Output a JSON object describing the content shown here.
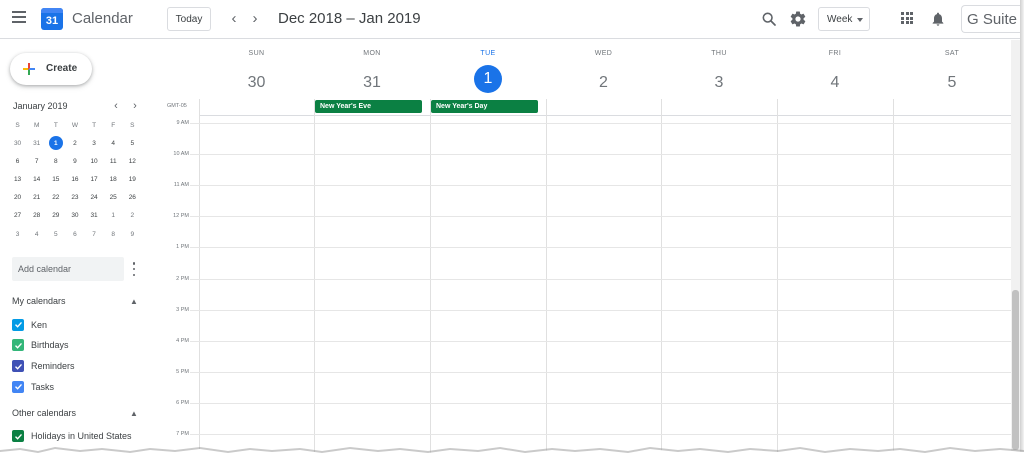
{
  "header": {
    "app_title": "Calendar",
    "logo_text": "31",
    "today_label": "Today",
    "prev_icon": "chevron-left-icon",
    "next_icon": "chevron-right-icon",
    "date_range": "Dec 2018 – Jan 2019",
    "view_label": "Week",
    "gsuite_label": "G Suite"
  },
  "sidebar": {
    "create_label": "Create",
    "mini_calendar": {
      "title": "January 2019",
      "dow": [
        "S",
        "M",
        "T",
        "W",
        "T",
        "F",
        "S"
      ],
      "weeks": [
        [
          "30",
          "31",
          "1",
          "2",
          "3",
          "4",
          "5"
        ],
        [
          "6",
          "7",
          "8",
          "9",
          "10",
          "11",
          "12"
        ],
        [
          "13",
          "14",
          "15",
          "16",
          "17",
          "18",
          "19"
        ],
        [
          "20",
          "21",
          "22",
          "23",
          "24",
          "25",
          "26"
        ],
        [
          "27",
          "28",
          "29",
          "30",
          "31",
          "1",
          "2"
        ],
        [
          "3",
          "4",
          "5",
          "6",
          "7",
          "8",
          "9"
        ]
      ],
      "today_cell": [
        0,
        2
      ]
    },
    "add_calendar_placeholder": "Add calendar",
    "my_calendars": {
      "title": "My calendars",
      "items": [
        {
          "label": "Ken",
          "color": "#039be5"
        },
        {
          "label": "Birthdays",
          "color": "#33b679"
        },
        {
          "label": "Reminders",
          "color": "#3f51b5"
        },
        {
          "label": "Tasks",
          "color": "#4285f4"
        }
      ]
    },
    "other_calendars": {
      "title": "Other calendars",
      "items": [
        {
          "label": "Holidays in United States",
          "color": "#0b8043"
        }
      ]
    }
  },
  "week": {
    "timezone": "GMT-05",
    "days": [
      {
        "dow": "SUN",
        "num": "30",
        "today": false
      },
      {
        "dow": "MON",
        "num": "31",
        "today": false
      },
      {
        "dow": "TUE",
        "num": "1",
        "today": true
      },
      {
        "dow": "WED",
        "num": "2",
        "today": false
      },
      {
        "dow": "THU",
        "num": "3",
        "today": false
      },
      {
        "dow": "FRI",
        "num": "4",
        "today": false
      },
      {
        "dow": "SAT",
        "num": "5",
        "today": false
      }
    ],
    "times": [
      "9 AM",
      "10 AM",
      "11 AM",
      "12 PM",
      "1 PM",
      "2 PM",
      "3 PM",
      "4 PM",
      "5 PM",
      "6 PM",
      "7 PM"
    ],
    "all_day_events": [
      {
        "label": "New Year's Eve",
        "day_index": 1,
        "color": "#0b8043"
      },
      {
        "label": "New Year's Day",
        "day_index": 2,
        "color": "#0b8043"
      }
    ]
  },
  "colors": {
    "accent": "#1a73e8",
    "event_green": "#0b8043"
  }
}
